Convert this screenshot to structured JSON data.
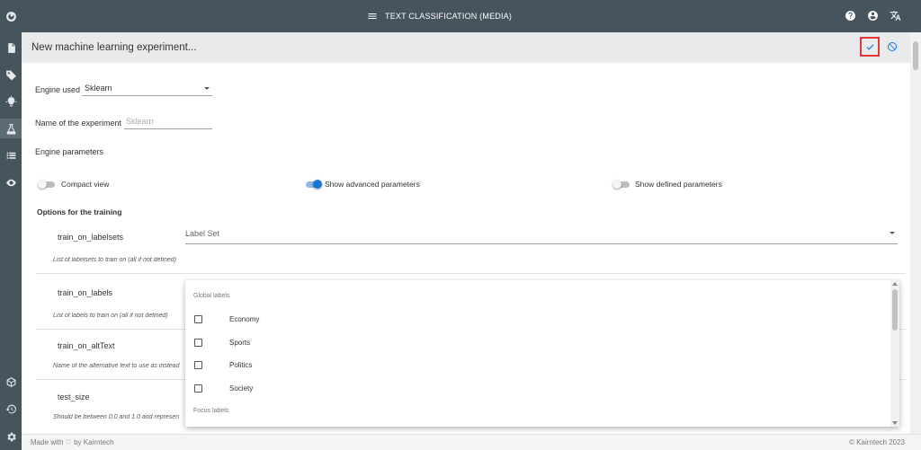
{
  "topbar": {
    "title": "TEXT CLASSIFICATION (MEDIA)",
    "icons": [
      "menu-icon",
      "help-icon",
      "account-icon",
      "translate-icon"
    ]
  },
  "sidebar": {
    "items": [
      "logo-icon",
      "documents-icon",
      "tag-icon",
      "lightbulb-icon",
      "flask-icon",
      "list-icon",
      "eye-icon",
      "package-icon",
      "history-icon",
      "settings-icon"
    ]
  },
  "header": {
    "title": "New machine learning experiment...",
    "confirm_icon": "check-icon",
    "cancel_icon": "cancel-icon"
  },
  "form": {
    "engine_label": "Engine used",
    "engine_value": "Sklearn",
    "name_label": "Name of the experiment",
    "name_placeholder": "Sklearn",
    "params_label": "Engine parameters",
    "compact_view": "Compact view",
    "compact_view_on": false,
    "show_advanced": "Show advanced parameters",
    "show_advanced_on": true,
    "show_defined": "Show defined parameters",
    "show_defined_on": false,
    "options_title": "Options for the training",
    "params": [
      {
        "name": "train_on_labelsets",
        "help": "List of labelsets to train on (all if not defined)",
        "placeholder": "Label Set"
      },
      {
        "name": "train_on_labels",
        "help": "List of labels to train on (all if not defined)"
      },
      {
        "name": "train_on_altText",
        "help": "Name of the alternative text to use as instead"
      },
      {
        "name": "test_size",
        "help": "Should be between 0.0 and 1.0 and represen"
      }
    ]
  },
  "dropdown": {
    "group1": "Global labels",
    "options": [
      "Economy",
      "Sports",
      "Politics",
      "Society"
    ],
    "group2": "Focus labels"
  },
  "footer": {
    "left": "Made with ♡ by Kairntech",
    "right": "©   Kairntech 2023"
  },
  "colors": {
    "chrome": "#46545e",
    "accent": "#1976d2",
    "highlight": "#e53935"
  }
}
